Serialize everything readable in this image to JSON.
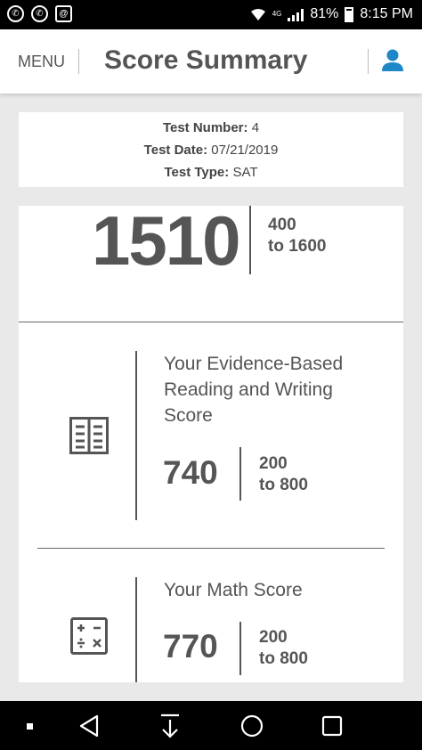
{
  "status_bar": {
    "battery": "81%",
    "time": "8:15 PM",
    "network": "4G",
    "icons": [
      "whatsapp-icon",
      "whatsapp-icon",
      "email-icon",
      "wifi-icon",
      "signal-icon",
      "battery-icon"
    ]
  },
  "header": {
    "menu_label": "MENU",
    "title": "Score Summary",
    "profile_icon": "user-icon"
  },
  "test_info": {
    "number_label": "Test Number:",
    "number": "4",
    "date_label": "Test Date:",
    "date": "07/21/2019",
    "type_label": "Test Type:",
    "type": "SAT"
  },
  "total": {
    "score": "1510",
    "range_min": "400",
    "range_max": "to 1600"
  },
  "sections": [
    {
      "title": "Your Evidence-Based Reading and Writing Score",
      "score": "740",
      "range_min": "200",
      "range_max": "to 800",
      "icon": "book-icon"
    },
    {
      "title": "Your Math Score",
      "score": "770",
      "range_min": "200",
      "range_max": "to 800",
      "icon": "calculator-icon"
    }
  ],
  "colors": {
    "accent": "#1e88c7",
    "text": "#555555",
    "background": "#e9e9e9"
  },
  "nav": [
    "dot-icon",
    "back-icon",
    "download-icon",
    "home-icon",
    "recents-icon"
  ]
}
